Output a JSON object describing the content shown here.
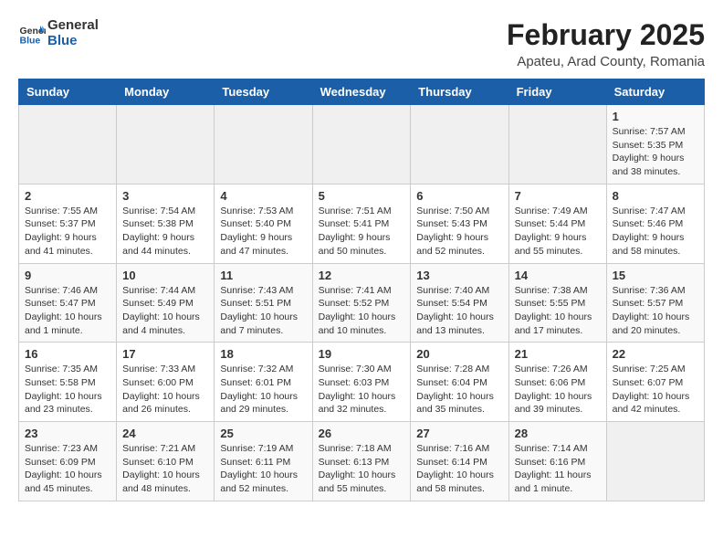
{
  "header": {
    "logo_general": "General",
    "logo_blue": "Blue",
    "main_title": "February 2025",
    "subtitle": "Apateu, Arad County, Romania"
  },
  "calendar": {
    "days_of_week": [
      "Sunday",
      "Monday",
      "Tuesday",
      "Wednesday",
      "Thursday",
      "Friday",
      "Saturday"
    ],
    "weeks": [
      [
        {
          "day": "",
          "info": ""
        },
        {
          "day": "",
          "info": ""
        },
        {
          "day": "",
          "info": ""
        },
        {
          "day": "",
          "info": ""
        },
        {
          "day": "",
          "info": ""
        },
        {
          "day": "",
          "info": ""
        },
        {
          "day": "1",
          "info": "Sunrise: 7:57 AM\nSunset: 5:35 PM\nDaylight: 9 hours and 38 minutes."
        }
      ],
      [
        {
          "day": "2",
          "info": "Sunrise: 7:55 AM\nSunset: 5:37 PM\nDaylight: 9 hours and 41 minutes."
        },
        {
          "day": "3",
          "info": "Sunrise: 7:54 AM\nSunset: 5:38 PM\nDaylight: 9 hours and 44 minutes."
        },
        {
          "day": "4",
          "info": "Sunrise: 7:53 AM\nSunset: 5:40 PM\nDaylight: 9 hours and 47 minutes."
        },
        {
          "day": "5",
          "info": "Sunrise: 7:51 AM\nSunset: 5:41 PM\nDaylight: 9 hours and 50 minutes."
        },
        {
          "day": "6",
          "info": "Sunrise: 7:50 AM\nSunset: 5:43 PM\nDaylight: 9 hours and 52 minutes."
        },
        {
          "day": "7",
          "info": "Sunrise: 7:49 AM\nSunset: 5:44 PM\nDaylight: 9 hours and 55 minutes."
        },
        {
          "day": "8",
          "info": "Sunrise: 7:47 AM\nSunset: 5:46 PM\nDaylight: 9 hours and 58 minutes."
        }
      ],
      [
        {
          "day": "9",
          "info": "Sunrise: 7:46 AM\nSunset: 5:47 PM\nDaylight: 10 hours and 1 minute."
        },
        {
          "day": "10",
          "info": "Sunrise: 7:44 AM\nSunset: 5:49 PM\nDaylight: 10 hours and 4 minutes."
        },
        {
          "day": "11",
          "info": "Sunrise: 7:43 AM\nSunset: 5:51 PM\nDaylight: 10 hours and 7 minutes."
        },
        {
          "day": "12",
          "info": "Sunrise: 7:41 AM\nSunset: 5:52 PM\nDaylight: 10 hours and 10 minutes."
        },
        {
          "day": "13",
          "info": "Sunrise: 7:40 AM\nSunset: 5:54 PM\nDaylight: 10 hours and 13 minutes."
        },
        {
          "day": "14",
          "info": "Sunrise: 7:38 AM\nSunset: 5:55 PM\nDaylight: 10 hours and 17 minutes."
        },
        {
          "day": "15",
          "info": "Sunrise: 7:36 AM\nSunset: 5:57 PM\nDaylight: 10 hours and 20 minutes."
        }
      ],
      [
        {
          "day": "16",
          "info": "Sunrise: 7:35 AM\nSunset: 5:58 PM\nDaylight: 10 hours and 23 minutes."
        },
        {
          "day": "17",
          "info": "Sunrise: 7:33 AM\nSunset: 6:00 PM\nDaylight: 10 hours and 26 minutes."
        },
        {
          "day": "18",
          "info": "Sunrise: 7:32 AM\nSunset: 6:01 PM\nDaylight: 10 hours and 29 minutes."
        },
        {
          "day": "19",
          "info": "Sunrise: 7:30 AM\nSunset: 6:03 PM\nDaylight: 10 hours and 32 minutes."
        },
        {
          "day": "20",
          "info": "Sunrise: 7:28 AM\nSunset: 6:04 PM\nDaylight: 10 hours and 35 minutes."
        },
        {
          "day": "21",
          "info": "Sunrise: 7:26 AM\nSunset: 6:06 PM\nDaylight: 10 hours and 39 minutes."
        },
        {
          "day": "22",
          "info": "Sunrise: 7:25 AM\nSunset: 6:07 PM\nDaylight: 10 hours and 42 minutes."
        }
      ],
      [
        {
          "day": "23",
          "info": "Sunrise: 7:23 AM\nSunset: 6:09 PM\nDaylight: 10 hours and 45 minutes."
        },
        {
          "day": "24",
          "info": "Sunrise: 7:21 AM\nSunset: 6:10 PM\nDaylight: 10 hours and 48 minutes."
        },
        {
          "day": "25",
          "info": "Sunrise: 7:19 AM\nSunset: 6:11 PM\nDaylight: 10 hours and 52 minutes."
        },
        {
          "day": "26",
          "info": "Sunrise: 7:18 AM\nSunset: 6:13 PM\nDaylight: 10 hours and 55 minutes."
        },
        {
          "day": "27",
          "info": "Sunrise: 7:16 AM\nSunset: 6:14 PM\nDaylight: 10 hours and 58 minutes."
        },
        {
          "day": "28",
          "info": "Sunrise: 7:14 AM\nSunset: 6:16 PM\nDaylight: 11 hours and 1 minute."
        },
        {
          "day": "",
          "info": ""
        }
      ]
    ]
  }
}
